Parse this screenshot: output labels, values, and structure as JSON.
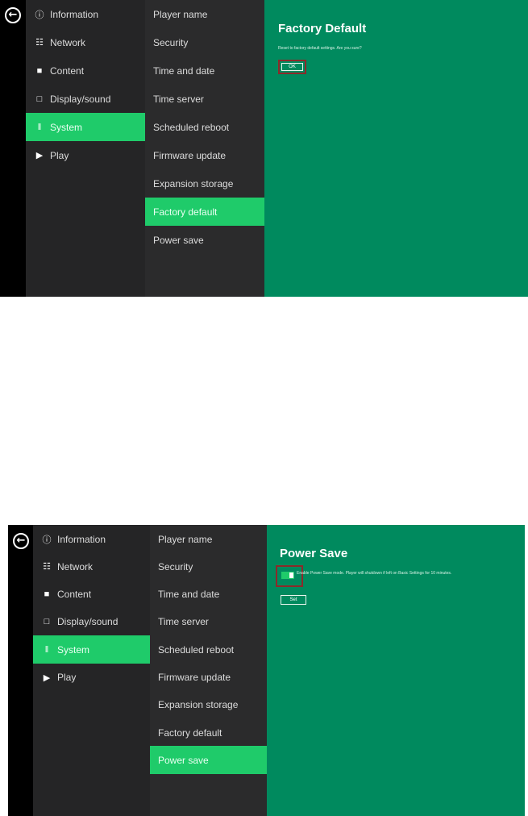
{
  "screen1": {
    "categories": [
      {
        "icon": "info-icon",
        "glyph": "ⓘ",
        "label": "Information"
      },
      {
        "icon": "network-icon",
        "glyph": "☷",
        "label": "Network"
      },
      {
        "icon": "content-icon",
        "glyph": "■",
        "label": "Content"
      },
      {
        "icon": "display-icon",
        "glyph": "□",
        "label": "Display/sound"
      },
      {
        "icon": "system-icon",
        "glyph": "‖",
        "label": "System"
      },
      {
        "icon": "play-icon",
        "glyph": "▶",
        "label": "Play"
      }
    ],
    "active_category": "System",
    "submenu": [
      "Player name",
      "Security",
      "Time and date",
      "Time server",
      "Scheduled reboot",
      "Firmware update",
      "Expansion storage",
      "Factory default",
      "Power save"
    ],
    "active_submenu": "Factory default",
    "content": {
      "title": "Factory Default",
      "description": "Reset to factory default settings. Are you sure?",
      "button_label": "OK"
    }
  },
  "screen2": {
    "categories": [
      {
        "icon": "info-icon",
        "glyph": "ⓘ",
        "label": "Information"
      },
      {
        "icon": "network-icon",
        "glyph": "☷",
        "label": "Network"
      },
      {
        "icon": "content-icon",
        "glyph": "■",
        "label": "Content"
      },
      {
        "icon": "display-icon",
        "glyph": "□",
        "label": "Display/sound"
      },
      {
        "icon": "system-icon",
        "glyph": "‖",
        "label": "System"
      },
      {
        "icon": "play-icon",
        "glyph": "▶",
        "label": "Play"
      }
    ],
    "active_category": "System",
    "submenu": [
      "Player name",
      "Security",
      "Time and date",
      "Time server",
      "Scheduled reboot",
      "Firmware update",
      "Expansion storage",
      "Factory default",
      "Power save"
    ],
    "active_submenu": "Power save",
    "content": {
      "title": "Power Save",
      "description": "Enable Power Save mode. Player will shutdown if left on Basic Settings for 10 minutes.",
      "toggle_on": true,
      "button_label": "Set"
    }
  },
  "colors": {
    "rail": "#000000",
    "category_bg": "#252526",
    "submenu_bg": "#2b2b2c",
    "content_bg": "#008a5e",
    "active": "#1fcb6a",
    "highlight": "#8b2a2a"
  },
  "back_icon": {
    "icon": "back-arrow-icon",
    "glyph": "←"
  }
}
